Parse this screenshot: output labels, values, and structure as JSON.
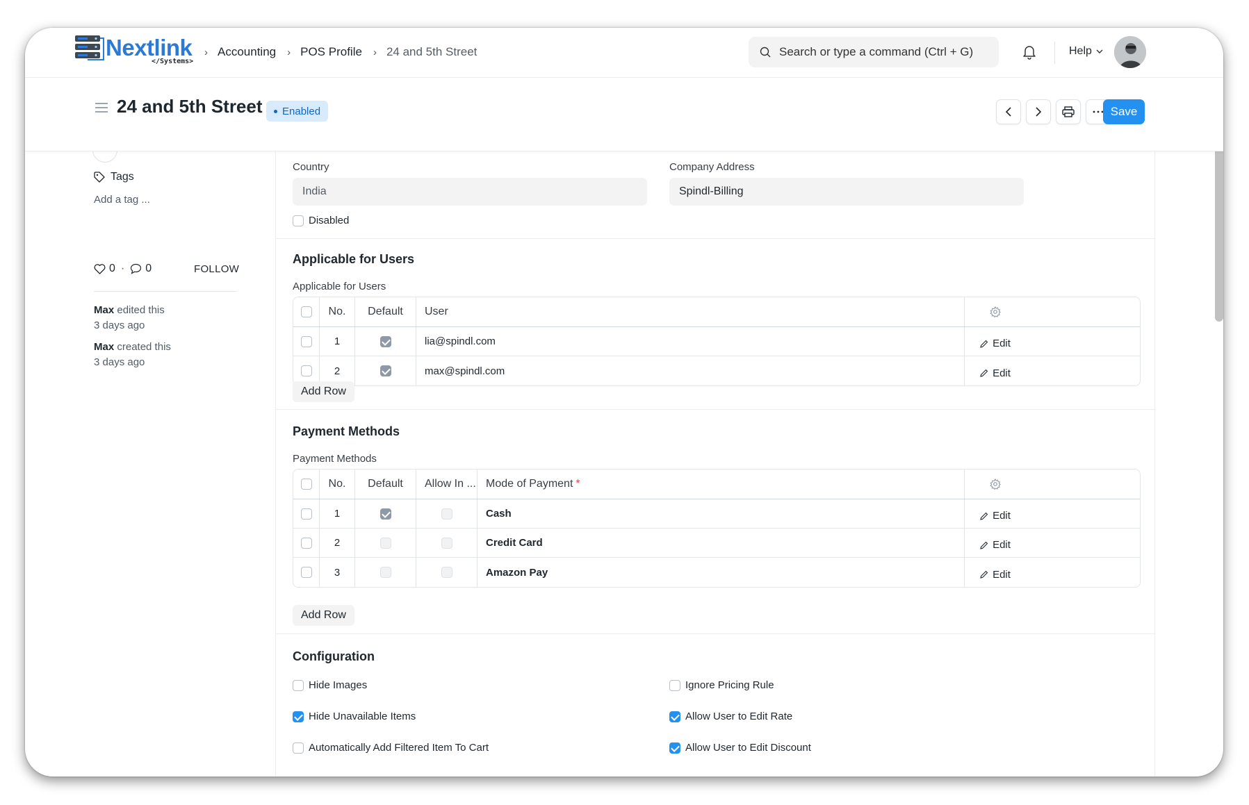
{
  "app": {
    "logo_text": "Nextlink",
    "logo_sub": "</Systems>"
  },
  "breadcrumbs": [
    "Accounting",
    "POS Profile",
    "24 and 5th Street"
  ],
  "search": {
    "placeholder": "Search or type a command (Ctrl + G)"
  },
  "help_label": "Help",
  "page": {
    "title": "24 and 5th Street",
    "status": "Enabled",
    "save_label": "Save"
  },
  "sidebar": {
    "tags_label": "Tags",
    "add_tag": "Add a tag ...",
    "likes": "0",
    "comments": "0",
    "follow": "FOLLOW",
    "activity": [
      {
        "user": "Max",
        "action": "edited this",
        "time": "3 days ago"
      },
      {
        "user": "Max",
        "action": "created this",
        "time": "3 days ago"
      }
    ]
  },
  "form": {
    "country_label": "Country",
    "country_value": "India",
    "company_address_label": "Company Address",
    "company_address_value": "Spindl-Billing",
    "disabled_label": "Disabled",
    "disabled_checked": false
  },
  "users_section": {
    "title": "Applicable for Users",
    "table_label": "Applicable for Users",
    "columns": [
      "No.",
      "Default",
      "User"
    ],
    "rows": [
      {
        "no": "1",
        "default": true,
        "user": "lia@spindl.com"
      },
      {
        "no": "2",
        "default": true,
        "user": "max@spindl.com"
      }
    ],
    "edit_label": "Edit",
    "add_row": "Add Row"
  },
  "payment_section": {
    "title": "Payment Methods",
    "table_label": "Payment Methods",
    "columns": [
      "No.",
      "Default",
      "Allow In ...",
      "Mode of Payment"
    ],
    "required_mark": "*",
    "rows": [
      {
        "no": "1",
        "default": true,
        "allow": false,
        "mode": "Cash"
      },
      {
        "no": "2",
        "default": false,
        "allow": false,
        "mode": "Credit Card"
      },
      {
        "no": "3",
        "default": false,
        "allow": false,
        "mode": "Amazon Pay"
      }
    ],
    "edit_label": "Edit",
    "add_row": "Add Row"
  },
  "config_section": {
    "title": "Configuration",
    "left": [
      {
        "label": "Hide Images",
        "checked": false
      },
      {
        "label": "Hide Unavailable Items",
        "checked": true
      },
      {
        "label": "Automatically Add Filtered Item To Cart",
        "checked": false
      }
    ],
    "right": [
      {
        "label": "Ignore Pricing Rule",
        "checked": false
      },
      {
        "label": "Allow User to Edit Rate",
        "checked": true
      },
      {
        "label": "Allow User to Edit Discount",
        "checked": true
      }
    ]
  },
  "colors": {
    "primary": "#2490ef",
    "badge_bg": "#d8ebfc",
    "badge_text": "#1366c2",
    "logo": "#2b7bd6"
  },
  "icons": [
    "search-icon",
    "bell-icon",
    "chevron-down-icon",
    "hamburger-icon",
    "chevron-left-icon",
    "chevron-right-icon",
    "printer-icon",
    "more-icon",
    "tag-icon",
    "heart-icon",
    "comment-icon",
    "gear-icon",
    "pencil-icon"
  ]
}
